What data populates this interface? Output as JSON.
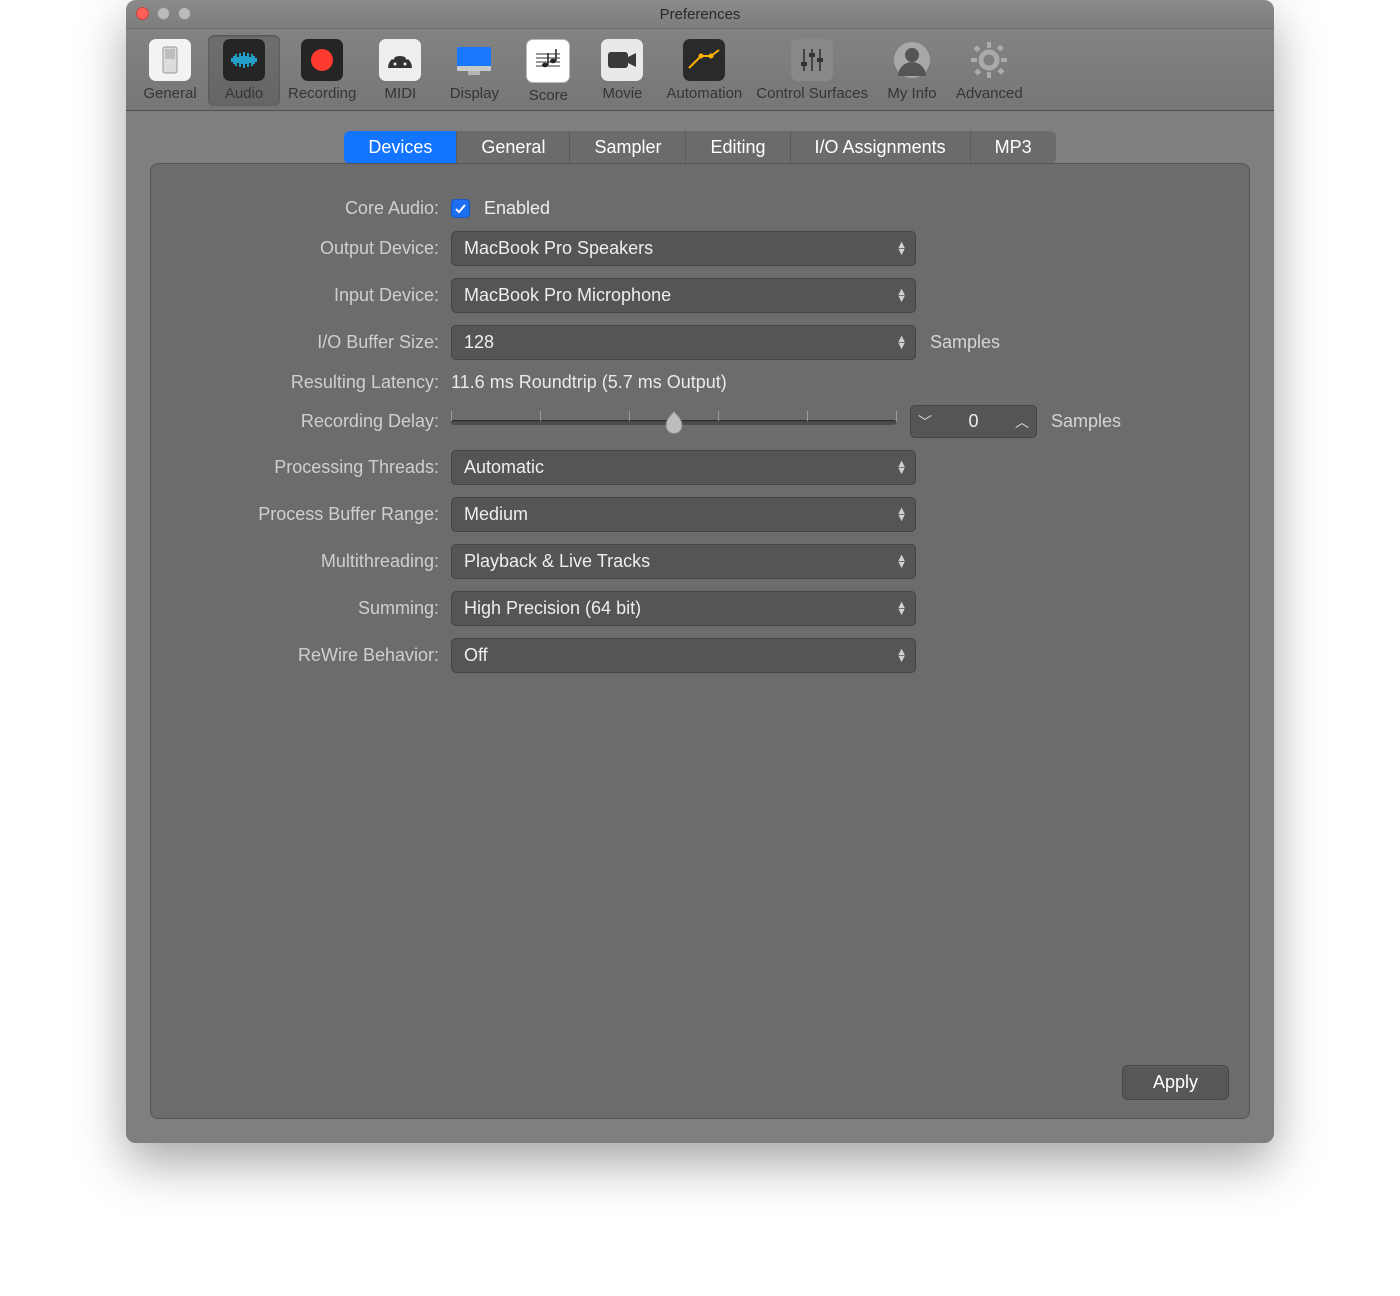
{
  "window": {
    "title": "Preferences"
  },
  "toolbar": {
    "items": [
      {
        "label": "General",
        "name": "general"
      },
      {
        "label": "Audio",
        "name": "audio",
        "active": true
      },
      {
        "label": "Recording",
        "name": "recording"
      },
      {
        "label": "MIDI",
        "name": "midi"
      },
      {
        "label": "Display",
        "name": "display"
      },
      {
        "label": "Score",
        "name": "score"
      },
      {
        "label": "Movie",
        "name": "movie"
      },
      {
        "label": "Automation",
        "name": "automation"
      },
      {
        "label": "Control Surfaces",
        "name": "control-surfaces"
      },
      {
        "label": "My Info",
        "name": "my-info"
      },
      {
        "label": "Advanced",
        "name": "advanced"
      }
    ]
  },
  "tabs": {
    "items": [
      {
        "label": "Devices",
        "name": "devices",
        "active": true
      },
      {
        "label": "General",
        "name": "general"
      },
      {
        "label": "Sampler",
        "name": "sampler"
      },
      {
        "label": "Editing",
        "name": "editing"
      },
      {
        "label": "I/O Assignments",
        "name": "io-assignments"
      },
      {
        "label": "MP3",
        "name": "mp3"
      }
    ]
  },
  "form": {
    "core_audio": {
      "label": "Core Audio:",
      "checkbox_label": "Enabled",
      "checked": true
    },
    "output_device": {
      "label": "Output Device:",
      "value": "MacBook Pro Speakers"
    },
    "input_device": {
      "label": "Input Device:",
      "value": "MacBook Pro Microphone"
    },
    "io_buffer_size": {
      "label": "I/O Buffer Size:",
      "value": "128",
      "suffix": "Samples"
    },
    "resulting_latency": {
      "label": "Resulting Latency:",
      "text": "11.6 ms Roundtrip (5.7 ms Output)"
    },
    "recording_delay": {
      "label": "Recording Delay:",
      "value": "0",
      "suffix": "Samples"
    },
    "processing_threads": {
      "label": "Processing Threads:",
      "value": "Automatic"
    },
    "process_buffer_range": {
      "label": "Process Buffer Range:",
      "value": "Medium"
    },
    "multithreading": {
      "label": "Multithreading:",
      "value": "Playback & Live Tracks"
    },
    "summing": {
      "label": "Summing:",
      "value": "High Precision (64 bit)"
    },
    "rewire_behavior": {
      "label": "ReWire Behavior:",
      "value": "Off"
    }
  },
  "footer": {
    "apply": "Apply"
  }
}
